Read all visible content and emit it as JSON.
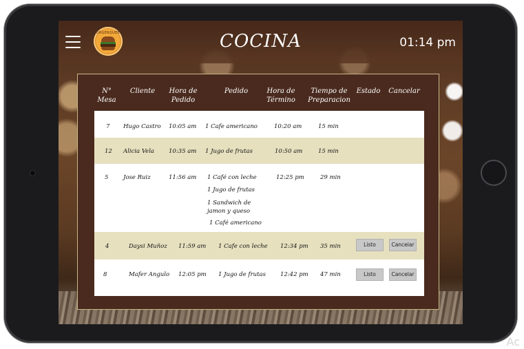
{
  "header": {
    "title": "COCINA",
    "time": "01:14 pm",
    "logo_text": "BURGERQUEEN"
  },
  "columns": {
    "mesa": "N° Mesa",
    "cliente": "Cliente",
    "hora_pedido": "Hora de Pedido",
    "pedido": "Pedido",
    "hora_termino": "Hora de Término",
    "tiempo": "Tiempo de Preparacion",
    "estado": "Estado",
    "cancelar": "Cancelar"
  },
  "orders": [
    {
      "mesa": "7",
      "cliente": "Hugo Castro",
      "hora_pedido": "10:05 am",
      "items": [
        "1 Cafe americano"
      ],
      "hora_termino": "10:20 am",
      "tiempo": "15 min"
    },
    {
      "mesa": "12",
      "cliente": "Alicia Vela",
      "hora_pedido": "10:35 am",
      "items": [
        "1 Jugo de frutas"
      ],
      "hora_termino": "10:50 am",
      "tiempo": "15 min"
    },
    {
      "mesa": "5",
      "cliente": "Jose Ruiz",
      "hora_pedido": "11:56 am",
      "items": [
        "1 Café con leche",
        "1 Jugo de frutas",
        "1 Sandwich de jamon y queso",
        "1 Café americano"
      ],
      "hora_termino": "12:25 pm",
      "tiempo": "29 min"
    },
    {
      "mesa": "4",
      "cliente": "Daysi Muñoz",
      "hora_pedido": "11:59 am",
      "items": [
        "1 Cafe con leche"
      ],
      "hora_termino": "12:34 pm",
      "tiempo": "35 min",
      "estado_btn": "Listo",
      "cancelar_btn": "Cancelar"
    },
    {
      "mesa": "8",
      "cliente": "Mafer Angulo",
      "hora_pedido": "12:05 pm",
      "items": [
        "1 Jugo de frutas"
      ],
      "hora_termino": "12:42 pm",
      "tiempo": "47 min",
      "estado_btn": "Listo",
      "cancelar_btn": "Cancelar"
    }
  ],
  "watermark": "Ac"
}
